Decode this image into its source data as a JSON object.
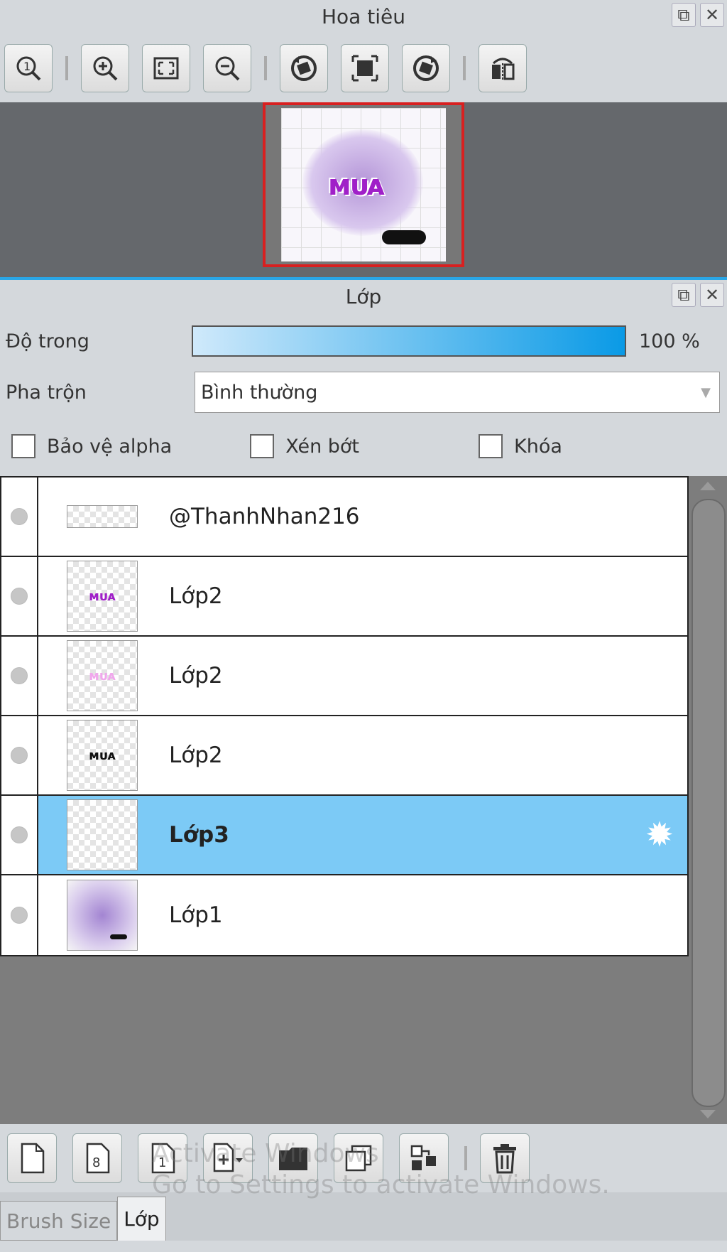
{
  "navigator": {
    "title": "Hoa tiêu",
    "title_buttons": [
      "popout-icon",
      "close-icon"
    ],
    "toolbar": [
      "zoom-actual-icon",
      "zoom-in-icon",
      "fit-screen-icon",
      "zoom-out-icon",
      "rotate-left-icon",
      "reset-view-icon",
      "rotate-right-icon",
      "flip-horizontal-icon"
    ]
  },
  "layers_panel": {
    "title": "Lớp",
    "opacity_label": "Độ trong",
    "opacity_value": "100 %",
    "opacity_fraction": 1.0,
    "blend_label": "Pha trộn",
    "blend_value": "Bình thường",
    "checkbox_alpha": "Bảo vệ alpha",
    "checkbox_clip": "Xén bớt",
    "checkbox_lock": "Khóa",
    "layers": [
      {
        "name": "@ThanhNhan216",
        "selected": false
      },
      {
        "name": "Lớp2",
        "selected": false
      },
      {
        "name": "Lớp2",
        "selected": false
      },
      {
        "name": "Lớp2",
        "selected": false
      },
      {
        "name": "Lớp3",
        "selected": true
      },
      {
        "name": "Lớp1",
        "selected": false
      }
    ],
    "toolbar": [
      "new-layer-icon",
      "new-8bit-layer-icon",
      "new-1bit-layer-icon",
      "add-layer-menu-icon",
      "new-folder-icon",
      "duplicate-layer-icon",
      "merge-down-icon",
      "delete-layer-icon"
    ]
  },
  "watermark": {
    "line1": "Activate Windows",
    "line2": "Go to Settings to activate Windows."
  },
  "tabs": [
    "Brush Size",
    "Lớp"
  ],
  "colors": {
    "selected_row": "#7ccaf6",
    "opacity_bar": "#0a9ae6",
    "preview_border": "#d82020"
  }
}
